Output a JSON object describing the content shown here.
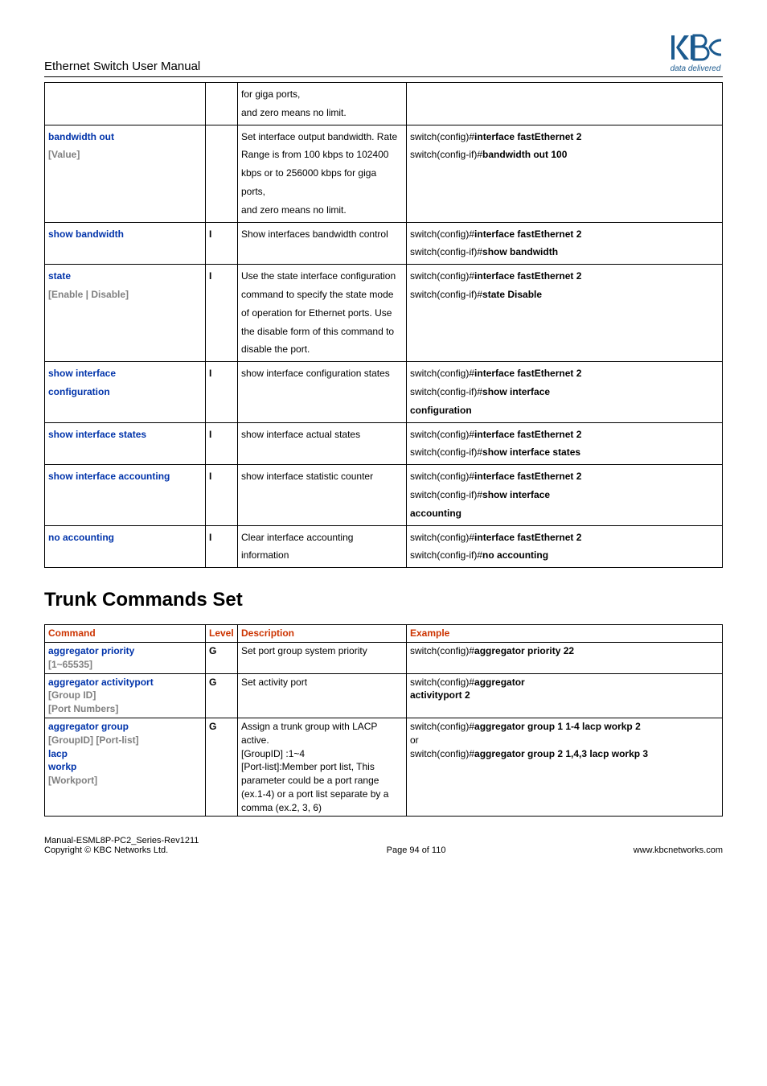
{
  "header": {
    "doc_title": "Ethernet Switch User Manual",
    "logo_tagline": "data delivered"
  },
  "table1": {
    "rows": [
      {
        "cmd_label": "",
        "cmd_param": "",
        "level": "",
        "desc": "for giga ports,\nand zero means no limit.",
        "example": ""
      },
      {
        "cmd_label": "bandwidth out",
        "cmd_param": "[Value]",
        "level": "",
        "desc": "Set interface output bandwidth. Rate Range is from 100 kbps to 102400 kbps or to 256000 kbps for giga ports,\nand zero means no limit.",
        "example_lines": [
          {
            "pre": "switch(config)#",
            "bold": "interface fastEthernet 2"
          },
          {
            "pre": "switch(config-if)#",
            "bold": "bandwidth out 100"
          }
        ]
      },
      {
        "cmd_label": "show bandwidth",
        "cmd_param": "",
        "level": "I",
        "desc": "Show interfaces bandwidth control",
        "example_lines": [
          {
            "pre": "switch(config)#",
            "bold": "interface fastEthernet 2"
          },
          {
            "pre": "switch(config-if)#",
            "bold": "show bandwidth"
          }
        ]
      },
      {
        "cmd_label": "state",
        "cmd_param": "[Enable | Disable]",
        "level": "I",
        "desc": "Use the state interface configuration command to specify the state mode of operation for Ethernet ports. Use the disable form of this command to disable the port.",
        "example_lines": [
          {
            "pre": "switch(config)#",
            "bold": "interface fastEthernet 2"
          },
          {
            "pre": "switch(config-if)#",
            "bold": "state Disable"
          }
        ]
      },
      {
        "cmd_label": "show interface",
        "cmd_label2": "configuration",
        "cmd_param": "",
        "level": "I",
        "desc": "show interface configuration states",
        "example_lines": [
          {
            "pre": "switch(config)#",
            "bold": "interface fastEthernet 2"
          },
          {
            "pre": "switch(config-if)#",
            "bold": "show interface"
          },
          {
            "pre": "",
            "bold": "configuration"
          }
        ]
      },
      {
        "cmd_label": "show interface states",
        "cmd_param": "",
        "level": "I",
        "desc": "show interface actual states",
        "example_lines": [
          {
            "pre": "switch(config)#",
            "bold": "interface fastEthernet 2"
          },
          {
            "pre": "switch(config-if)#",
            "bold": "show interface states"
          }
        ]
      },
      {
        "cmd_label": "show interface accounting",
        "cmd_param": "",
        "level": "I",
        "desc": "show interface statistic counter",
        "example_lines": [
          {
            "pre": "switch(config)#",
            "bold": "interface fastEthernet 2"
          },
          {
            "pre": "switch(config-if)#",
            "bold": "show interface"
          },
          {
            "pre": "",
            "bold": "accounting"
          }
        ]
      },
      {
        "cmd_label": "no accounting",
        "cmd_param": "",
        "level": "I",
        "desc": "Clear interface accounting information",
        "example_lines": [
          {
            "pre": "switch(config)#",
            "bold": "interface fastEthernet 2"
          },
          {
            "pre": "switch(config-if)#",
            "bold": "no accounting"
          }
        ]
      }
    ]
  },
  "section_title": "Trunk Commands Set",
  "table2": {
    "headers": [
      "Command",
      "Level",
      "Description",
      "Example"
    ],
    "rows": [
      {
        "cmd_label": "aggregator priority",
        "cmd_param": "[1~65535]",
        "level": "G",
        "desc": "Set port group system priority",
        "example_lines": [
          {
            "pre": "switch(config)#",
            "bold": "aggregator priority 22"
          }
        ]
      },
      {
        "cmd_label": "aggregator activityport",
        "cmd_param_lines": [
          "[Group ID]",
          "[Port Numbers]"
        ],
        "level": "G",
        "desc": "Set activity port",
        "example_lines": [
          {
            "pre": "switch(config)#",
            "bold": "aggregator"
          },
          {
            "pre": "",
            "bold": "activityport 2"
          }
        ]
      },
      {
        "cmd_label": "aggregator group",
        "cmd_mixed": [
          {
            "type": "param",
            "text": "[GroupID] [Port-list]"
          },
          {
            "type": "label",
            "text": "lacp"
          },
          {
            "type": "label",
            "text": "workp"
          },
          {
            "type": "param",
            "text": "[Workport]"
          }
        ],
        "level": "G",
        "desc": "Assign a trunk group with LACP active.\n[GroupID] :1~4\n[Port-list]:Member port list, This parameter could be a port range (ex.1-4) or a port list separate by a comma (ex.2, 3, 6)",
        "example_lines": [
          {
            "pre": "switch(config)#",
            "bold": "aggregator group 1 1-4 lacp workp 2"
          },
          {
            "pre": "or",
            "bold": ""
          },
          {
            "pre": "switch(config)#",
            "bold": "aggregator group 2 1,4,3 lacp workp 3"
          }
        ]
      }
    ]
  },
  "footer": {
    "left_line1": "Manual-ESML8P-PC2_Series-Rev1211",
    "left_line2": "Copyright © KBC Networks Ltd.",
    "center": "Page 94 of 110",
    "right": "www.kbcnetworks.com"
  }
}
